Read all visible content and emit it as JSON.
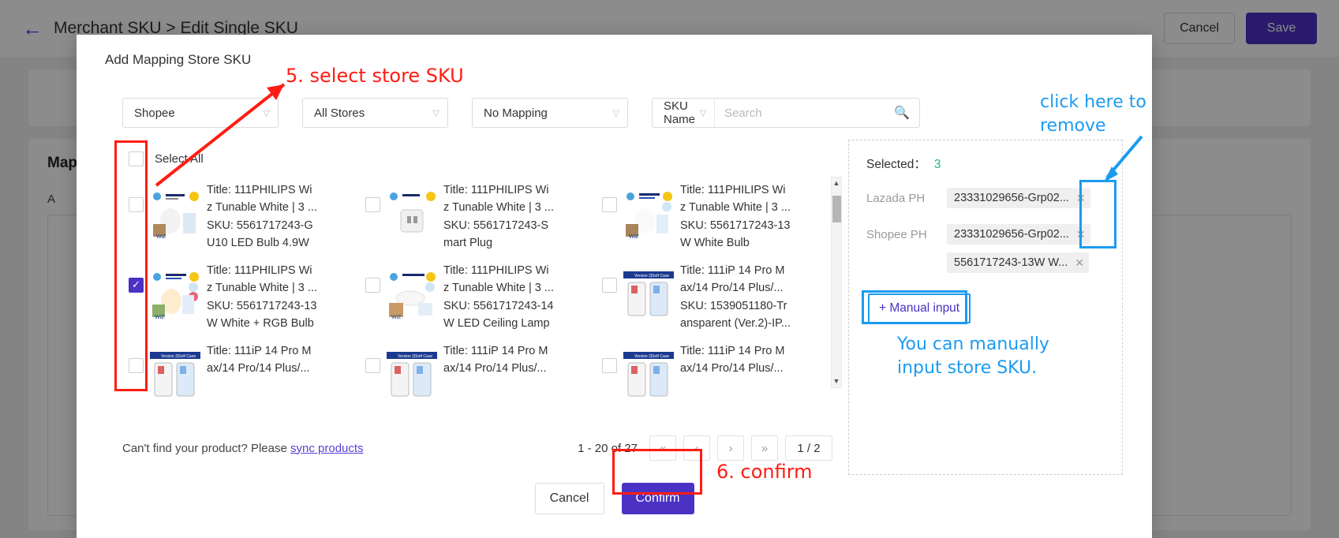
{
  "background": {
    "back_icon": "arrow-left-icon",
    "title": "Merchant SKU > Edit Single SKU",
    "cancel_label": "Cancel",
    "save_label": "Save",
    "section_title": "Map",
    "section_sub": "A"
  },
  "modal": {
    "title": "Add Mapping Store SKU",
    "filters": {
      "platform": "Shopee",
      "store": "All Stores",
      "mapping": "No Mapping",
      "search_type": "SKU Name",
      "search_value": "",
      "search_placeholder": "Search",
      "search_icon": "search-icon",
      "caret_icon": "chevron-down-icon"
    },
    "select_all_label": "Select All",
    "products": [
      {
        "checked": false,
        "title": "Title: 111PHILIPS Wi",
        "title2": "z Tunable White | 3 ...",
        "sku": "SKU: 5561717243-G",
        "sku2": "U10 LED Bulb 4.9W",
        "thumb": "philips-gu10-bulb-thumb"
      },
      {
        "checked": false,
        "title": "Title: 111PHILIPS Wi",
        "title2": "z Tunable White | 3 ...",
        "sku": "SKU: 5561717243-S",
        "sku2": "mart Plug",
        "thumb": "philips-smart-plug-thumb"
      },
      {
        "checked": false,
        "title": "Title: 111PHILIPS Wi",
        "title2": "z Tunable White | 3 ...",
        "sku": "SKU: 5561717243-13",
        "sku2": "W White Bulb",
        "thumb": "philips-13w-white-bulb-thumb"
      },
      {
        "checked": true,
        "title": "Title: 111PHILIPS Wi",
        "title2": "z Tunable White | 3 ...",
        "sku": "SKU: 5561717243-13",
        "sku2": "W White + RGB Bulb",
        "thumb": "philips-13w-rgb-bulb-thumb"
      },
      {
        "checked": false,
        "title": "Title: 111PHILIPS Wi",
        "title2": "z Tunable White | 3 ...",
        "sku": "SKU: 5561717243-14",
        "sku2": "W LED Ceiling Lamp",
        "thumb": "philips-ceiling-lamp-thumb"
      },
      {
        "checked": false,
        "title": "Title: 111iP 14 Pro M",
        "title2": "ax/14 Pro/14 Plus/...",
        "sku": "SKU: 1539051180-Tr",
        "sku2": "ansparent (Ver.2)-IP...",
        "thumb": "iphone-case-thumb"
      },
      {
        "checked": false,
        "title": "Title: 111iP 14 Pro M",
        "title2": "ax/14 Pro/14 Plus/...",
        "sku": "",
        "sku2": "",
        "thumb": "iphone-case-thumb"
      },
      {
        "checked": false,
        "title": "Title: 111iP 14 Pro M",
        "title2": "ax/14 Pro/14 Plus/...",
        "sku": "",
        "sku2": "",
        "thumb": "iphone-case-thumb"
      },
      {
        "checked": false,
        "title": "Title: 111iP 14 Pro M",
        "title2": "ax/14 Pro/14 Plus/...",
        "sku": "",
        "sku2": "",
        "thumb": "iphone-case-thumb"
      }
    ],
    "footer": {
      "hint_prefix": "Can't find your product? Please ",
      "sync_link": "sync products",
      "range_text": "1 - 20 of 27",
      "first_icon": "«",
      "prev_icon": "‹",
      "next_icon": "›",
      "last_icon": "»",
      "page_indicator": "1 / 2"
    },
    "selected_panel": {
      "label": "Selected：",
      "count": "3",
      "rows": [
        {
          "store": "Lazada PH",
          "sku": "23331029656-Grp02...",
          "remove_icon": "close-icon"
        },
        {
          "store": "Shopee PH",
          "sku": "23331029656-Grp02...",
          "remove_icon": "close-icon"
        },
        {
          "store": "",
          "sku": "5561717243-13W W...",
          "remove_icon": "close-icon"
        }
      ],
      "manual_input_label": "+ Manual input"
    },
    "cancel_label": "Cancel",
    "confirm_label": "Confirm"
  },
  "annotations": {
    "step5": "5. select store SKU",
    "step6": "6. confirm",
    "click_remove_line1": "click here to",
    "click_remove_line2": "remove",
    "manual_note_line1": "You can manually",
    "manual_note_line2": "input store SKU."
  },
  "colors": {
    "accent_purple": "#4b31c4",
    "annotation_red": "#ff1c12",
    "annotation_blue": "#1b9bf0",
    "count_green": "#20b884"
  }
}
